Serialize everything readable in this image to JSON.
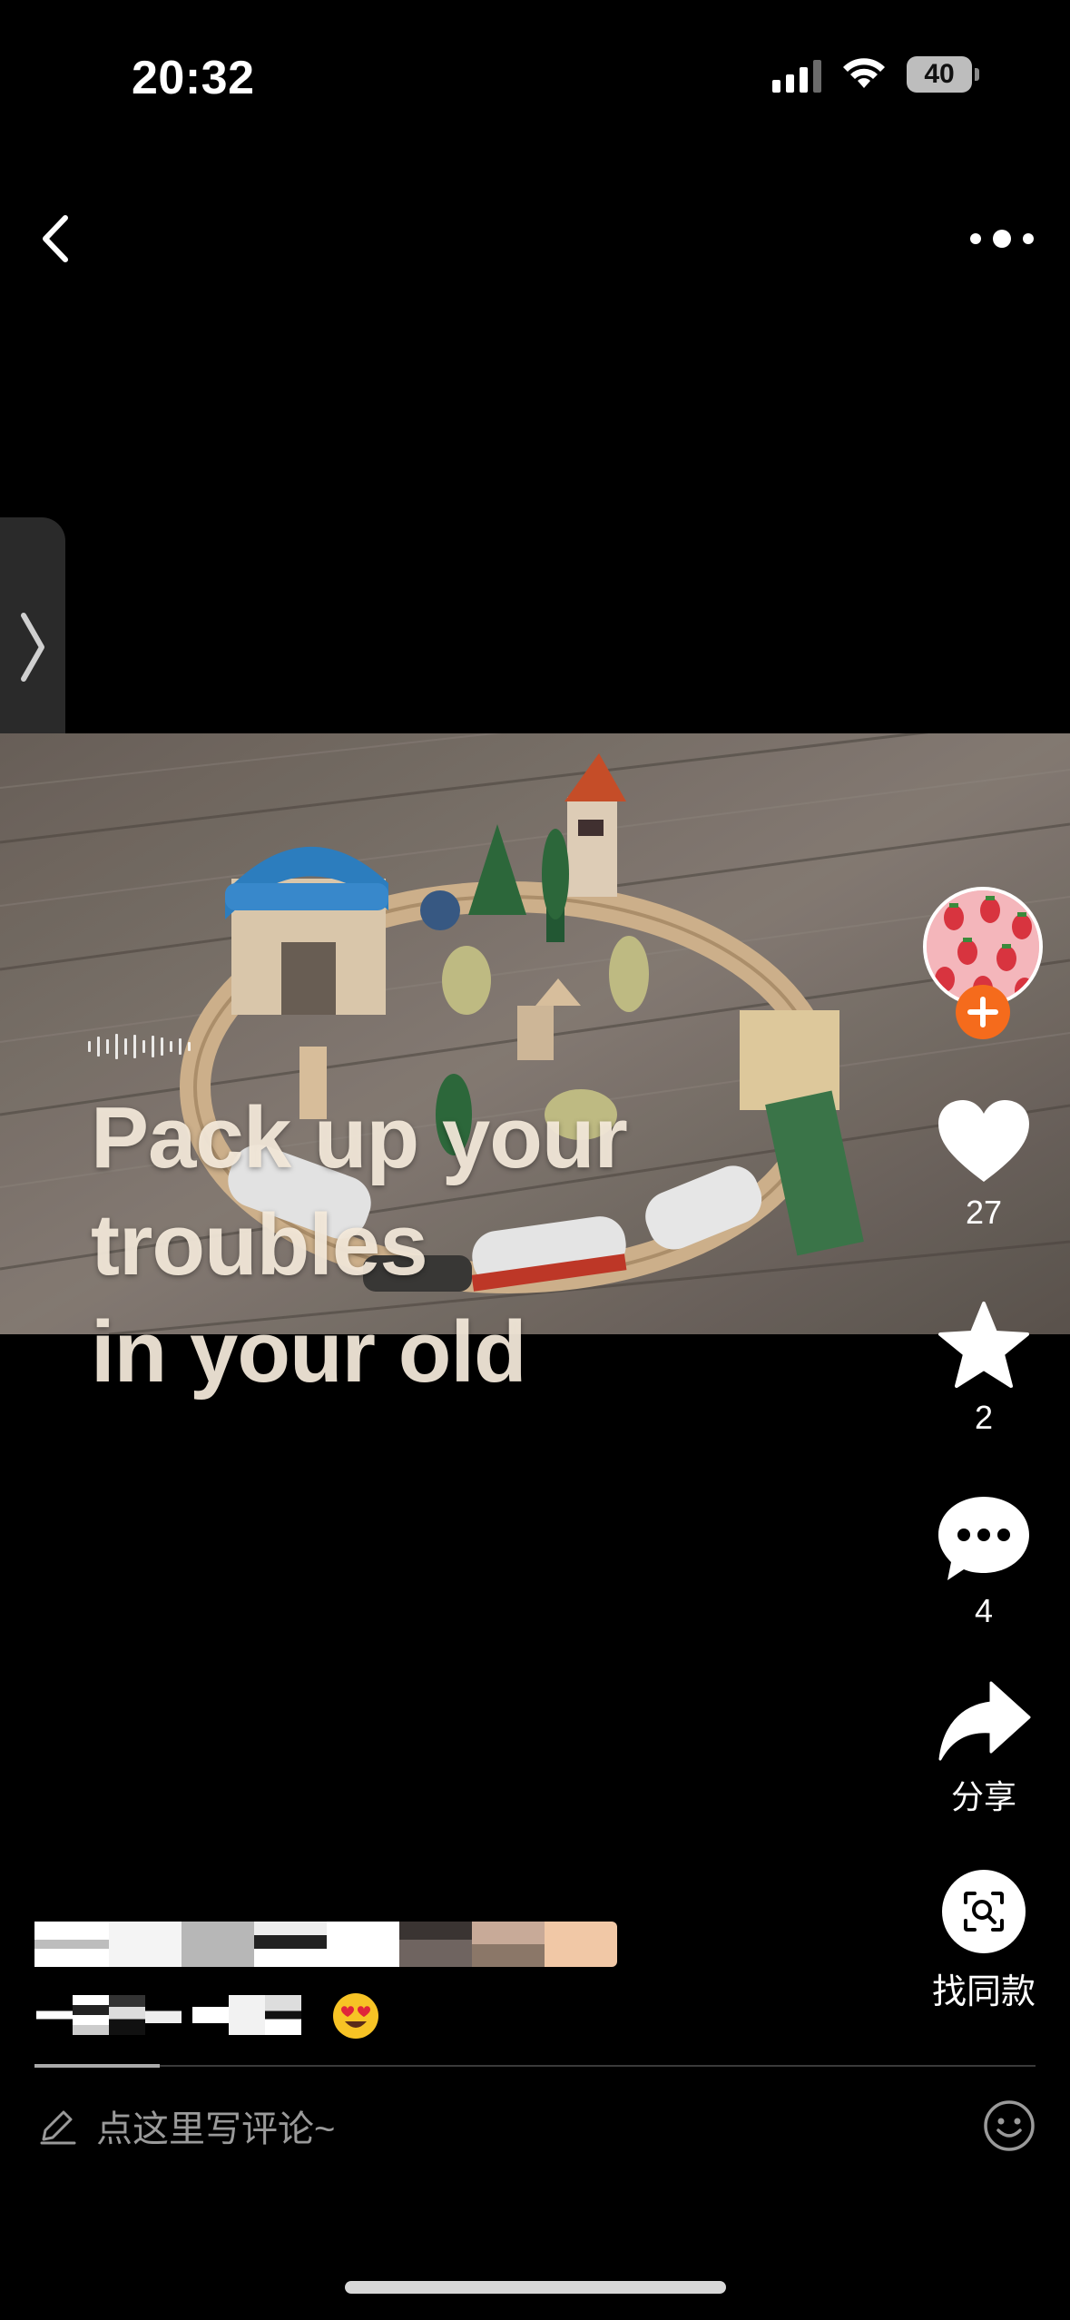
{
  "status_bar": {
    "time": "20:32",
    "battery": "40"
  },
  "video": {
    "caption_line1": "Pack up your troubles",
    "caption_line2": "in your old"
  },
  "actions": {
    "like_count": "27",
    "favorite_count": "2",
    "comment_count": "4",
    "share_label": "分享",
    "find_similar_label": "找同款"
  },
  "comment_bar": {
    "placeholder": "点这里写评论~"
  },
  "colors": {
    "follow_accent": "#f56b1c",
    "background": "#000000"
  },
  "icons": [
    "back-icon",
    "more-icon",
    "chevron-right-icon",
    "heart-icon",
    "star-icon",
    "comment-icon",
    "share-icon",
    "scan-search-icon",
    "pencil-icon",
    "smile-icon",
    "follow-plus-icon"
  ]
}
